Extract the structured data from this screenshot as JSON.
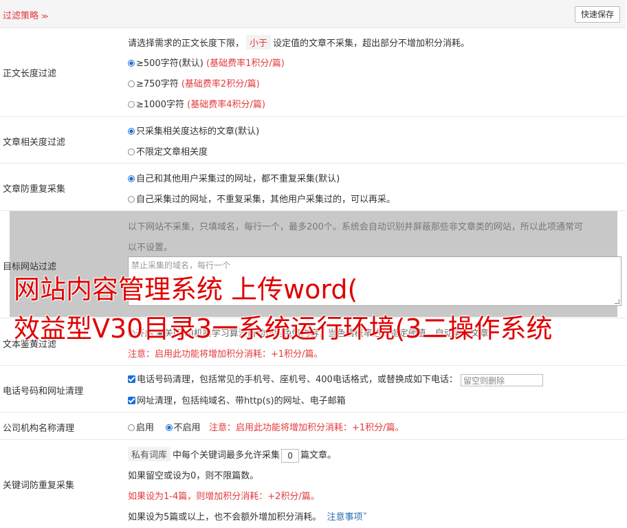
{
  "header": {
    "title": "过滤策略",
    "save_label": "快速保存"
  },
  "length_filter": {
    "label": "正文长度过滤",
    "desc_prefix": "请选择需求的正文长度下限，",
    "desc_pill": "小于",
    "desc_suffix": "设定值的文章不采集，超出部分不增加积分消耗。",
    "options": [
      {
        "text": "≥500字符(默认)",
        "note": "(基础费率1积分/篇)",
        "selected": true
      },
      {
        "text": "≥750字符",
        "note": "(基础费率2积分/篇)",
        "selected": false
      },
      {
        "text": "≥1000字符",
        "note": "(基础费率4积分/篇)",
        "selected": false
      }
    ]
  },
  "relevance_filter": {
    "label": "文章相关度过滤",
    "options": [
      {
        "text": "只采集相关度达标的文章(默认)",
        "selected": true
      },
      {
        "text": "不限定文章相关度",
        "selected": false
      }
    ]
  },
  "dedup": {
    "label": "文章防重复采集",
    "options": [
      {
        "text": "自己和其他用户采集过的网址，都不重复采集(默认)",
        "selected": true
      },
      {
        "text": "自己采集过的网址，不重复采集，其他用户采集过的，可以再采。",
        "selected": false
      }
    ]
  },
  "site_filter": {
    "label": "目标网站过滤",
    "desc_line1": "以下网站不采集，只填域名，每行一个，最多200个。系统会自动识别并屏蔽那些非文章类的网站，所以此项通常可",
    "desc_line2": "以不设置。",
    "placeholder": "禁止采集的域名，每行一个"
  },
  "porn_filter": {
    "label": "文本鉴黄过滤",
    "line_text": "○开启 ◉关闭 AI机器学习算法自动识别色情内容，当色情概率达到指定阈值，自动屏蔽文章。",
    "note": "注意：启用此功能将增加积分消耗：+1积分/篇。"
  },
  "phone_url": {
    "label": "电话号码和网址清理",
    "phone_text": "电话号码清理，包括常见的手机号、座机号、400电话格式，或替换成如下电话：",
    "phone_placeholder": "留空则删除",
    "url_text": "网址清理，包括纯域名、带http(s)的网址、电子邮箱"
  },
  "org_name": {
    "label": "公司机构名称清理",
    "enable": "启用",
    "disable": "不启用",
    "note": "注意：启用此功能将增加积分消耗：+1积分/篇。"
  },
  "keyword_dedup": {
    "label": "关键词防重复采集",
    "pill": "私有词库",
    "text_a": "中每个关键词最多允许采集",
    "value": "0",
    "text_b": "篇文章。",
    "line2": "如果留空或设为0，则不限篇数。",
    "line3": "如果设为1-4篇，则增加积分消耗：+2积分/篇。",
    "line4": "如果设为5篇或以上，也不会额外增加积分消耗。",
    "link": "注意事项"
  },
  "overlay": {
    "line1": "网站内容管理系统 上传word(",
    "line2": "效益型V30目录3一系统运行环境(3二操作系统"
  },
  "colors": {
    "accent": "#e4393c",
    "link": "#2a6db3",
    "selected": "#1a6fd6"
  }
}
